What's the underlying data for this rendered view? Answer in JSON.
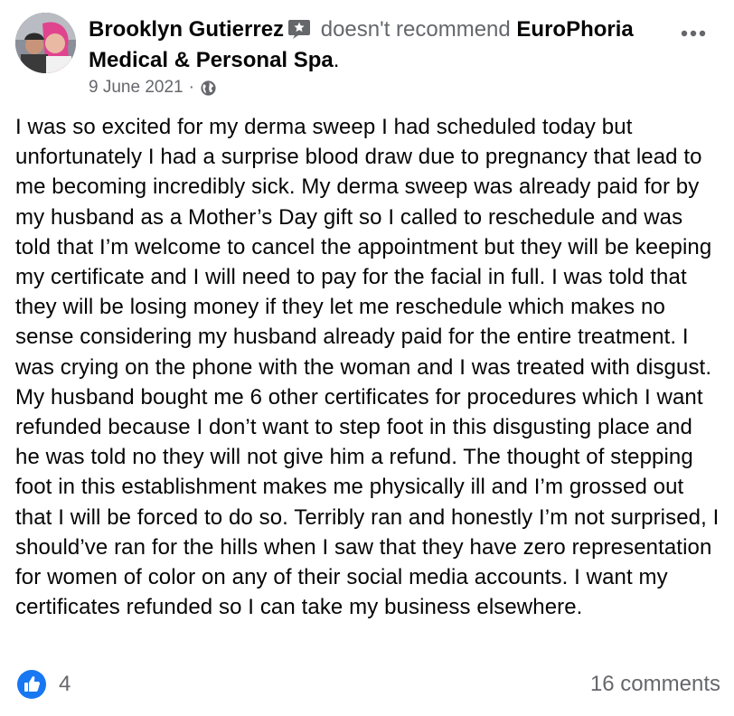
{
  "post": {
    "author": "Brooklyn Gutierrez",
    "verb": "doesn't recommend",
    "page_name": "EuroPhoria Medical & Personal Spa",
    "punctuation": ".",
    "date": "9 June 2021",
    "separator": "·",
    "privacy_icon": "globe-icon",
    "more_icon": "more-options-icon",
    "badge_icon": "star-badge-icon",
    "body": "I was so excited for my derma sweep I had scheduled today but unfortunately I had a surprise blood draw due to pregnancy that lead to me becoming incredibly sick. My derma sweep was already paid for by my husband as a Mother’s Day gift so I called to reschedule and was told that I’m welcome to cancel the appointment but they will be keeping my certificate and I will need to pay for the facial in full. I was told that they will be losing money if they let me reschedule which makes no sense considering my husband already paid for the entire treatment. I was crying on the phone with the woman and I was treated with disgust. My husband bought me 6 other certificates for procedures which I want refunded because I don’t want to step foot in this disgusting place and he was told no they will not give him a refund. The thought of stepping foot in this establishment makes me physically ill and I’m grossed out that I will be forced to do so. Terribly ran and honestly I’m not surprised, I should’ve ran for the hills when I saw that they have zero representation for women of color on any of their social media accounts. I want my certificates refunded so I can take my business elsewhere."
  },
  "footer": {
    "like_icon": "like-thumb-icon",
    "like_count": "4",
    "comments": "16 comments"
  },
  "colors": {
    "text": "#050505",
    "secondary": "#65676b",
    "like_blue": "#1877f2"
  }
}
